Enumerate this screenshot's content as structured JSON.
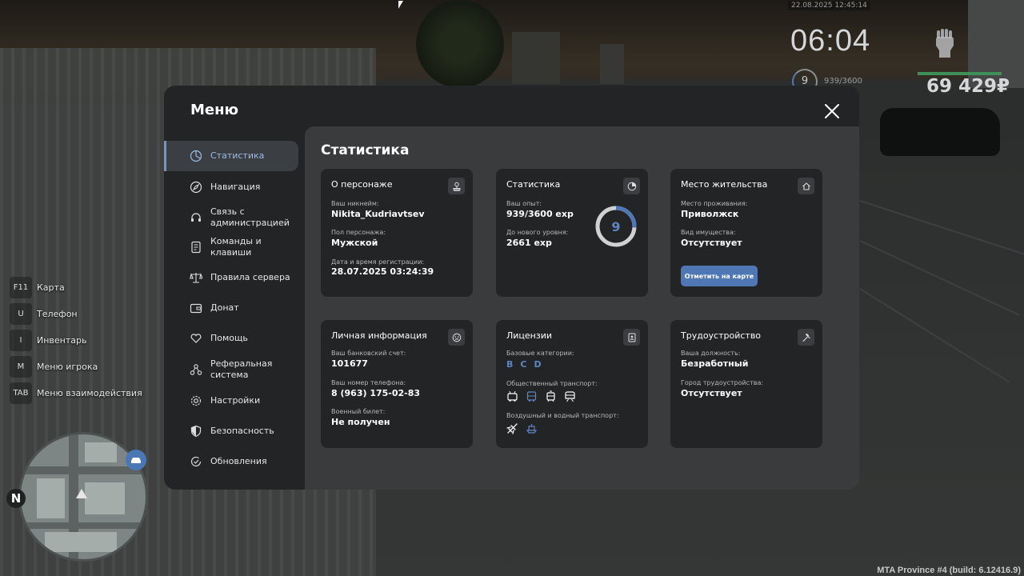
{
  "hud": {
    "date": "22.08.2025 12:45:14",
    "clock": "06:04",
    "level": "9",
    "exp": "939/3600",
    "money": "69 429₽"
  },
  "keybinds": [
    {
      "key": "F11",
      "label": "Карта"
    },
    {
      "key": "U",
      "label": "Телефон"
    },
    {
      "key": "I",
      "label": "Инвентарь"
    },
    {
      "key": "M",
      "label": "Меню игрока"
    },
    {
      "key": "TAB",
      "label": "Меню взаимодействия"
    }
  ],
  "minimap": {
    "north": "N"
  },
  "build_info": "MTA Province #4 (build: 6.12416.9)",
  "menu": {
    "title": "Меню",
    "sidebar": [
      {
        "label": "Статистика",
        "icon": "chart-pie-icon",
        "active": true
      },
      {
        "label": "Навигация",
        "icon": "compass-icon"
      },
      {
        "label": "Связь с администрацией",
        "icon": "headset-icon"
      },
      {
        "label": "Команды и клавиши",
        "icon": "document-icon"
      },
      {
        "label": "Правила сервера",
        "icon": "scales-icon"
      },
      {
        "label": "Донат",
        "icon": "wallet-icon"
      },
      {
        "label": "Помощь",
        "icon": "heart-hand-icon"
      },
      {
        "label": "Реферальная система",
        "icon": "network-icon"
      },
      {
        "label": "Настройки",
        "icon": "gear-icon"
      },
      {
        "label": "Безопасность",
        "icon": "shield-icon"
      },
      {
        "label": "Обновления",
        "icon": "refresh-check-icon"
      }
    ]
  },
  "content": {
    "title": "Статистика",
    "character": {
      "title": "О персонаже",
      "nickname_label": "Ваш никнейм:",
      "nickname": "Nikita_Kudriavtsev",
      "gender_label": "Пол персонажа:",
      "gender": "Мужской",
      "reg_label": "Дата и время регистрации:",
      "reg": "28.07.2025 03:24:39"
    },
    "stats": {
      "title": "Статистика",
      "exp_label": "Ваш опыт:",
      "exp": "939/3600 exp",
      "next_label": "До нового уровня:",
      "next": "2661 exp",
      "level": "9",
      "progress": 0.26
    },
    "residence": {
      "title": "Место жительства",
      "place_label": "Место проживания:",
      "place": "Приволжск",
      "property_label": "Вид имущества:",
      "property": "Отсутствует",
      "button": "Отметить на карте"
    },
    "personal": {
      "title": "Личная информация",
      "bank_label": "Ваш банковский счет:",
      "bank": "101677",
      "phone_label": "Ваш номер телефона:",
      "phone": "8 (963) 175-02-83",
      "military_label": "Военный билет:",
      "military": "Не получен"
    },
    "licenses": {
      "title": "Лицензии",
      "base_label": "Базовые категории:",
      "categories": [
        "B",
        "C",
        "D"
      ],
      "public_label": "Общественный транспорт:",
      "air_label": "Воздушный и водный транспорт:"
    },
    "employment": {
      "title": "Трудоустройство",
      "position_label": "Ваша должность:",
      "position": "Безработный",
      "city_label": "Город трудоустройства:",
      "city": "Отсутствует"
    }
  },
  "colors": {
    "accent": "#4f77b4",
    "accent_text": "#5f86c2",
    "panel": "#232425",
    "content": "#3a3b3d"
  }
}
